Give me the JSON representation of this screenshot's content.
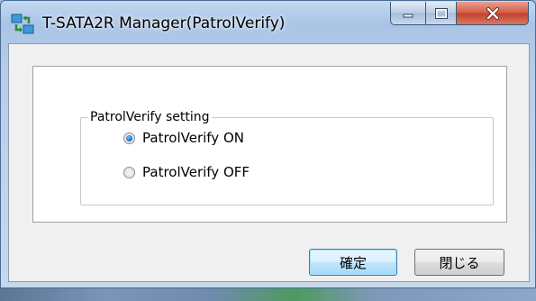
{
  "window": {
    "title": "T-SATA2R Manager(PatrolVerify)",
    "icon": "patrolverify-app-icon",
    "caption_buttons": [
      "minimize-icon",
      "maximize-icon",
      "close-icon"
    ]
  },
  "group": {
    "legend": "PatrolVerify  setting",
    "options": [
      {
        "label": "PatrolVerify  ON",
        "checked": true
      },
      {
        "label": "PatrolVerify  OFF",
        "checked": false
      }
    ]
  },
  "buttons": {
    "ok_label": "確定",
    "close_label": "閉じる"
  },
  "colors": {
    "close_button": "#c2412c",
    "radio_selected": "#1f6fcb"
  }
}
